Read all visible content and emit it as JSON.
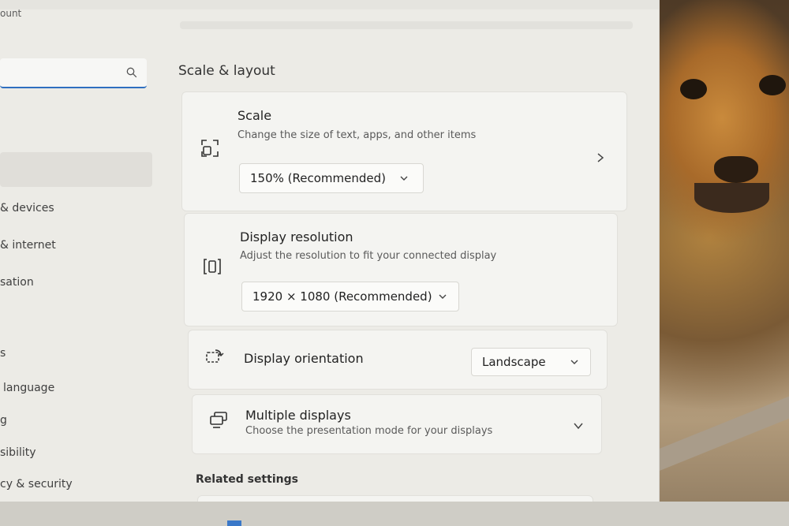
{
  "sidebar": {
    "account_label": "ount",
    "search": {
      "placeholder": "",
      "value": ""
    },
    "items": [
      {
        "label": "& devices"
      },
      {
        "label": "& internet"
      },
      {
        "label": "sation"
      },
      {
        "label": "s"
      },
      {
        "label": "language"
      },
      {
        "label": "g"
      },
      {
        "label": "sibility"
      },
      {
        "label": "cy & security"
      }
    ]
  },
  "main": {
    "section_title": "Scale & layout",
    "scale": {
      "title": "Scale",
      "subtitle": "Change the size of text, apps, and other items",
      "value": "150% (Recommended)"
    },
    "resolution": {
      "title": "Display resolution",
      "subtitle": "Adjust the resolution to fit your connected display",
      "value": "1920 × 1080 (Recommended)"
    },
    "orientation": {
      "title": "Display orientation",
      "value": "Landscape"
    },
    "multiple_displays": {
      "title": "Multiple displays",
      "subtitle": "Choose the presentation mode for your displays"
    },
    "related_title": "Related settings"
  },
  "icons": {
    "search": "search-icon",
    "scale": "scale-icon",
    "resolution": "resolution-icon",
    "orientation": "orientation-icon",
    "multiple_displays": "multiple-displays-icon"
  },
  "colors": {
    "accent": "#2f6fc0"
  }
}
